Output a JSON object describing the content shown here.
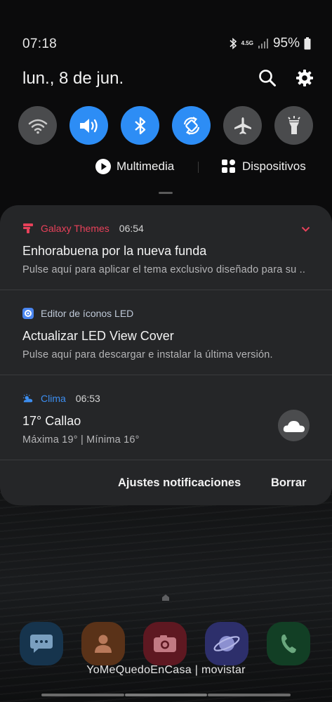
{
  "status_bar": {
    "time": "07:18",
    "network": "4.5G",
    "battery": "95%"
  },
  "header": {
    "date": "lun., 8 de jun.",
    "icons": [
      "search-icon",
      "gear-icon"
    ]
  },
  "quick_settings": [
    {
      "name": "wifi",
      "icon": "wifi-icon",
      "state": "off"
    },
    {
      "name": "sound",
      "icon": "volume-icon",
      "state": "on"
    },
    {
      "name": "bluetooth",
      "icon": "bluetooth-icon",
      "state": "on"
    },
    {
      "name": "auto-rotate",
      "icon": "rotate-icon",
      "state": "on"
    },
    {
      "name": "airplane",
      "icon": "airplane-icon",
      "state": "off"
    },
    {
      "name": "flashlight",
      "icon": "flashlight-icon",
      "state": "off"
    }
  ],
  "media_row": {
    "multimedia_label": "Multimedia",
    "devices_label": "Dispositivos"
  },
  "notifications": [
    {
      "app": "Galaxy Themes",
      "time": "06:54",
      "title": "Enhorabuena por la nueva funda",
      "body": "Pulse aquí para aplicar el tema exclusivo diseñado para su ..",
      "accent": "#e8415a"
    },
    {
      "app": "Editor de íconos LED",
      "title": "Actualizar LED View Cover",
      "body": "Pulse aquí para descargar e instalar la última versión.",
      "accent": "#4a86f0"
    },
    {
      "app": "Clima",
      "time": "06:53",
      "title": "17° Callao",
      "body": "Máxima 19° | Mínima 16°",
      "accent": "#3d8ef0"
    }
  ],
  "actions": {
    "settings_label": "Ajustes notificaciones",
    "clear_label": "Borrar"
  },
  "carrier_text": "YoMeQuedoEnCasa | movistar",
  "colors": {
    "accent_blue": "#2d8df5",
    "panel_bg": "#252628",
    "toggle_off": "#4a4b4d"
  }
}
